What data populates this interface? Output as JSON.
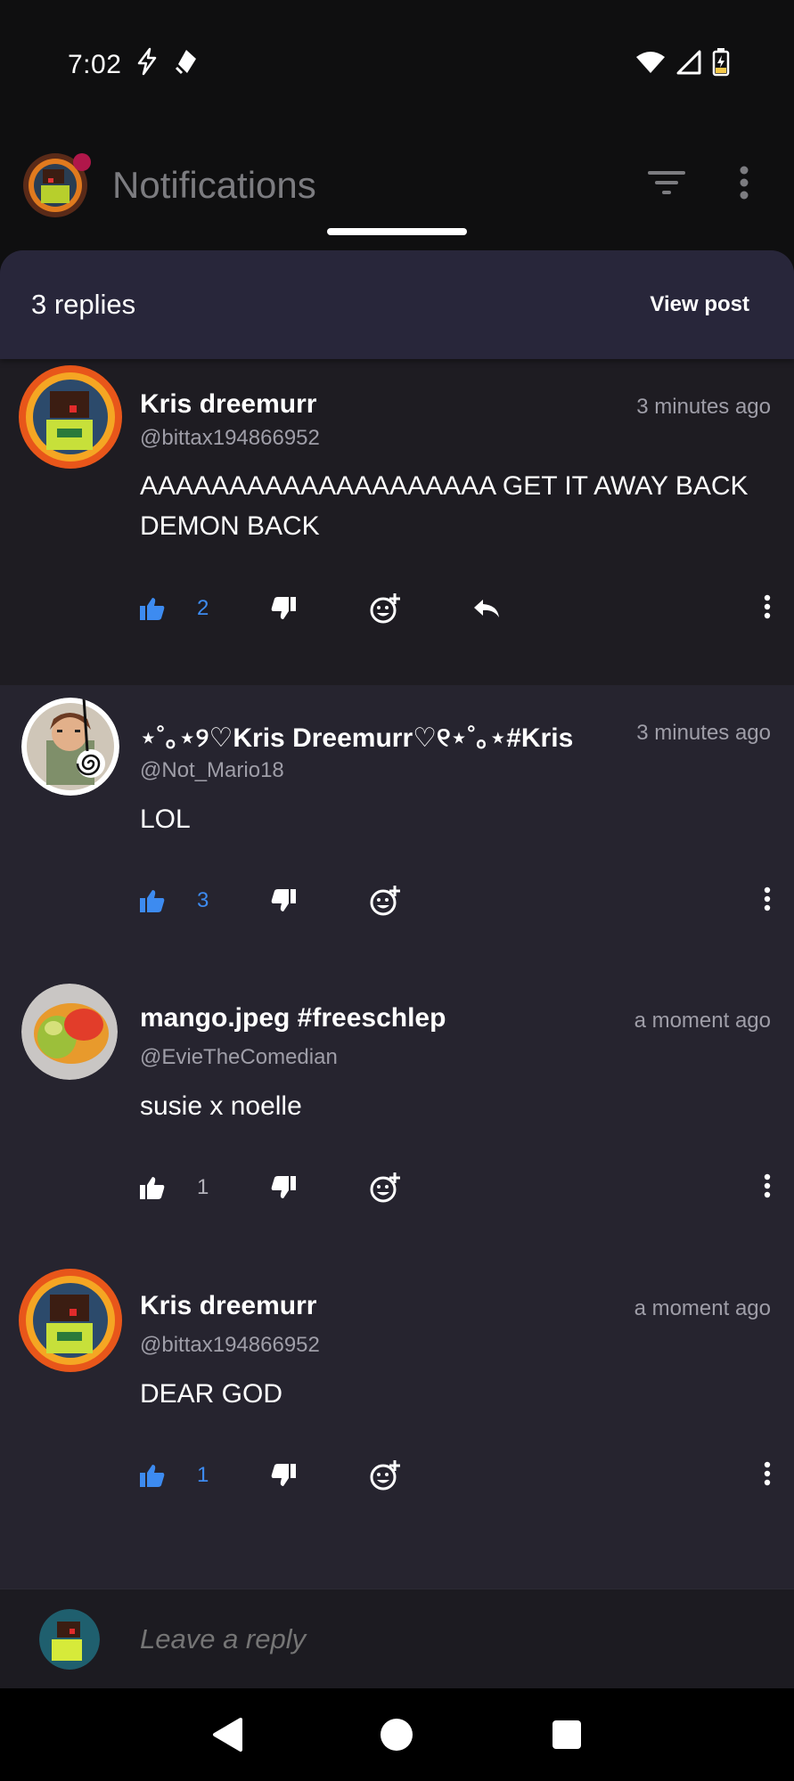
{
  "status": {
    "time": "7:02"
  },
  "appbar": {
    "title": "Notifications"
  },
  "sheet": {
    "replies_label": "3 replies",
    "view_post_label": "View post"
  },
  "comments": [
    {
      "name": "Kris dreemurr",
      "handle": "@bittax194866952",
      "time": "3 minutes ago",
      "text": "AAAAAAAAAAAAAAAAAAAA GET IT AWAY BACK DEMON BACK",
      "likes": "2",
      "liked": true
    },
    {
      "name": "⋆˚｡⋆୨♡Kris Dreemurr♡୧⋆˚｡⋆#Kris",
      "handle": "@Not_Mario18",
      "time": "3 minutes ago",
      "text": "LOL",
      "likes": "3",
      "liked": true
    },
    {
      "name": "mango.jpeg #freeschlep",
      "handle": "@EvieTheComedian",
      "time": "a moment ago",
      "text": "susie x noelle",
      "likes": "1",
      "liked": false
    },
    {
      "name": "Kris dreemurr",
      "handle": "@bittax194866952",
      "time": "a moment ago",
      "text": "DEAR GOD",
      "likes": "1",
      "liked": true
    }
  ],
  "reply": {
    "placeholder": "Leave a reply"
  },
  "colors": {
    "accent_blue": "#3d8bf0",
    "sheet_bg": "#26242f",
    "highlight_bg": "#1e1c22"
  },
  "icons": [
    "filter-icon",
    "more-vert-icon",
    "thumb-up-icon",
    "thumb-down-icon",
    "add-reaction-icon",
    "reply-icon",
    "back-nav-icon",
    "home-nav-icon",
    "recents-nav-icon"
  ]
}
